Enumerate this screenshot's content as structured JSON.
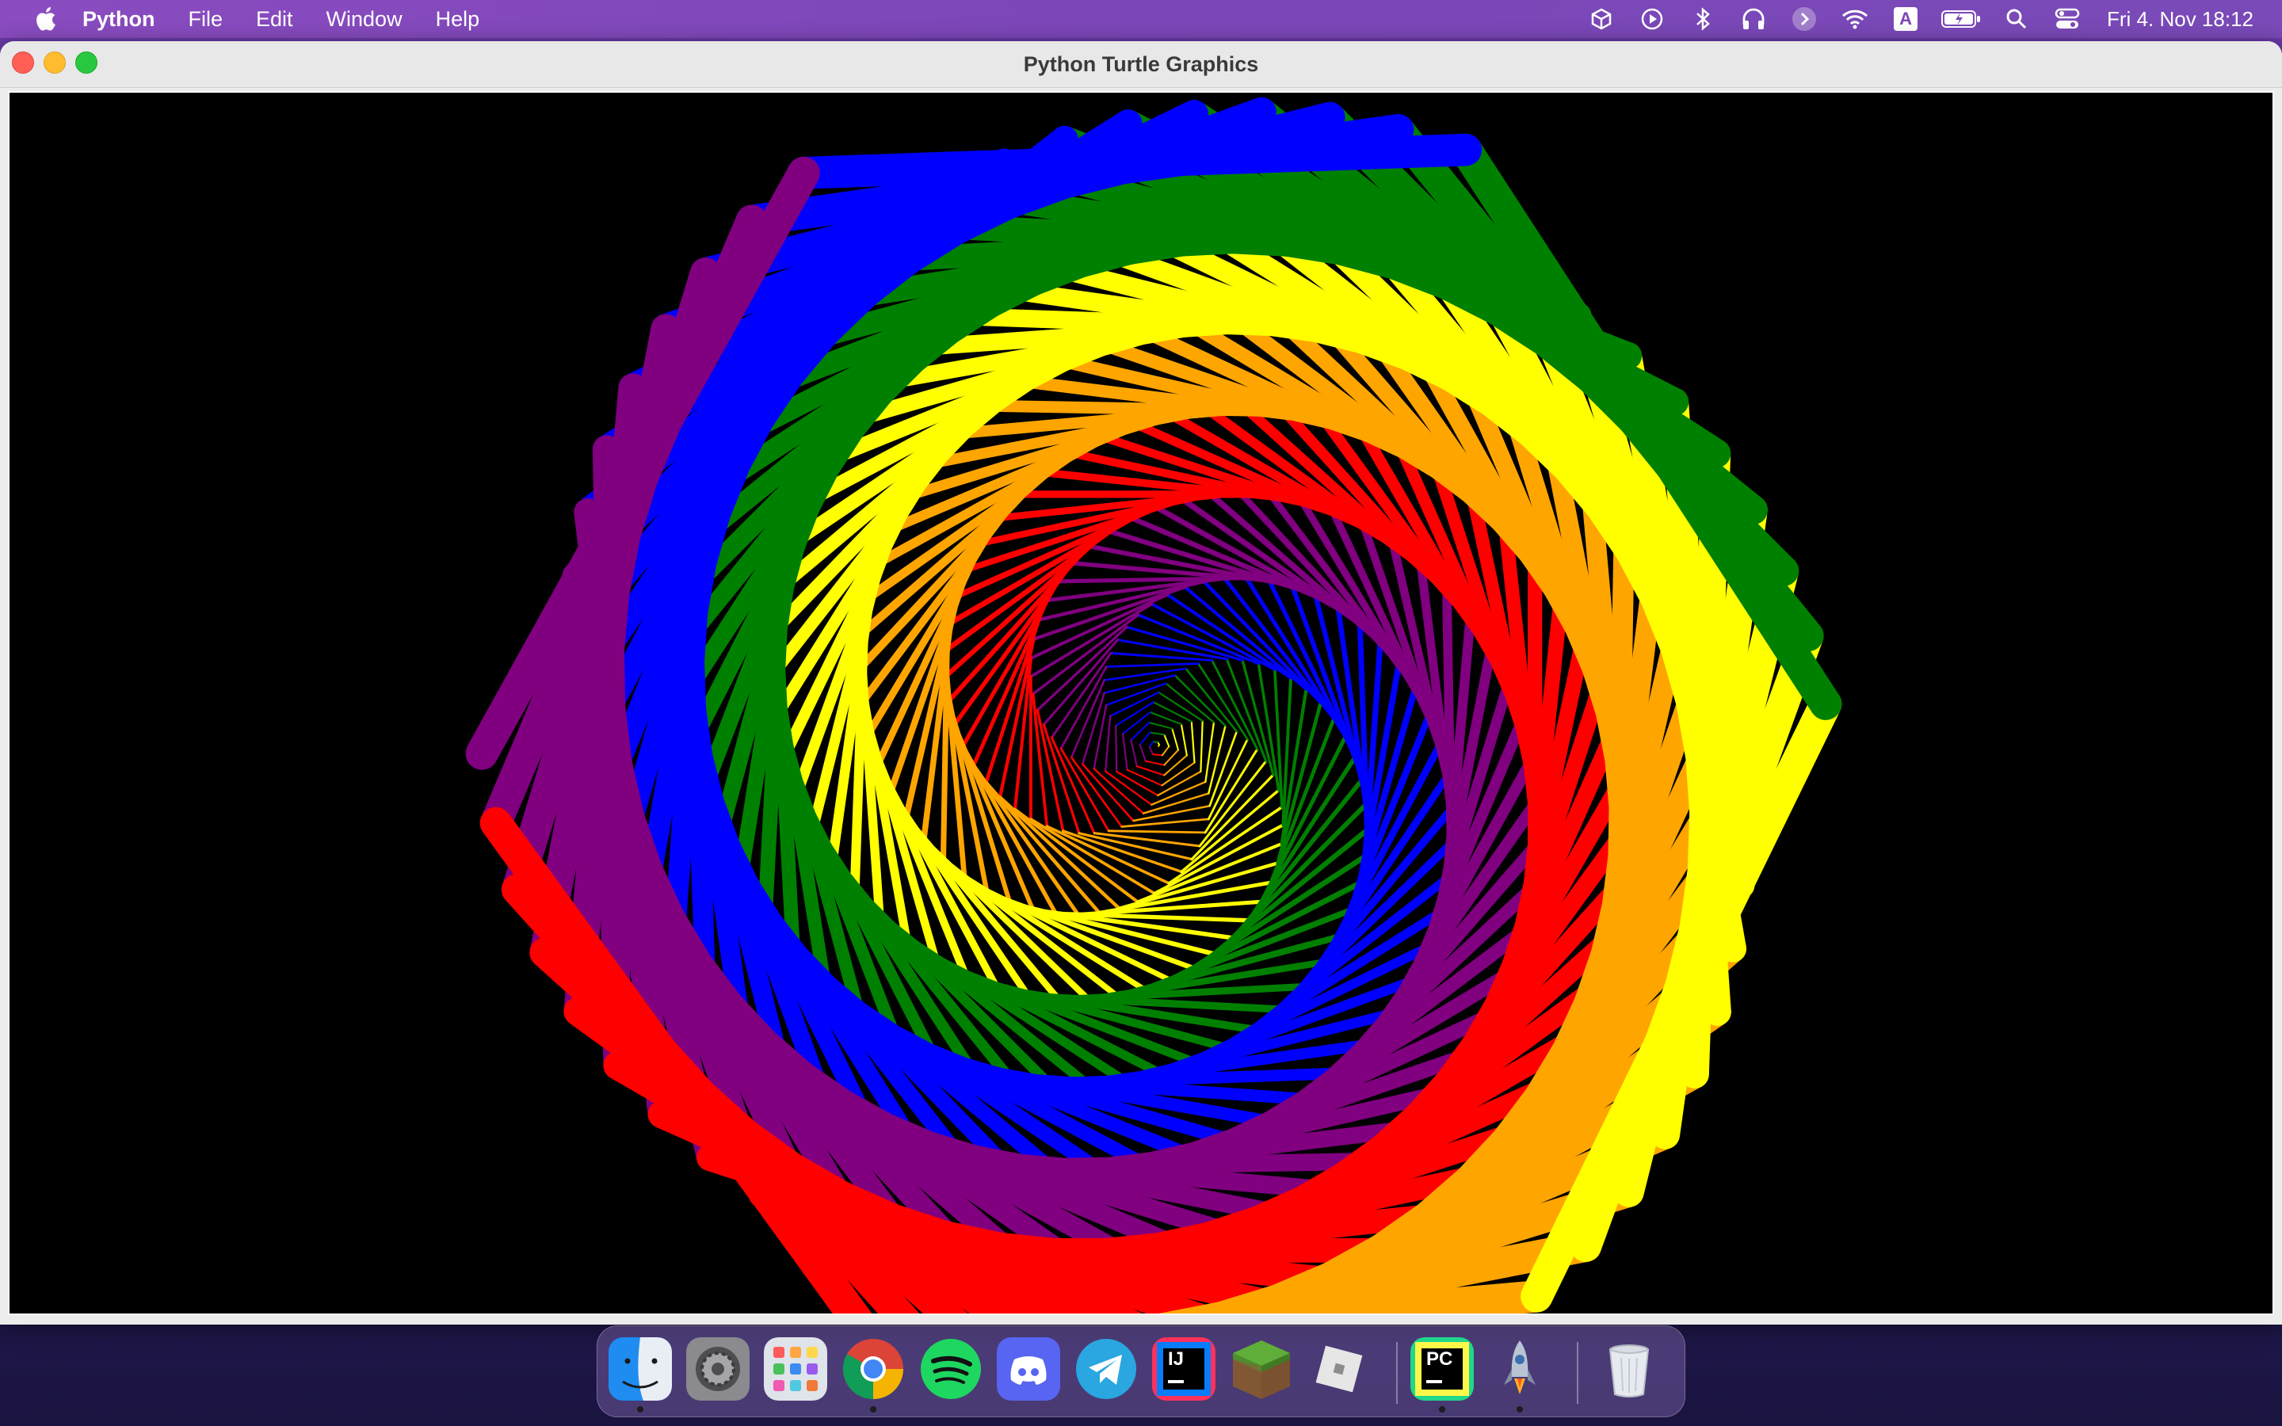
{
  "menubar": {
    "app_name": "Python",
    "menus": [
      "File",
      "Edit",
      "Window",
      "Help"
    ],
    "status_icons": [
      "box-icon",
      "play-icon",
      "bluetooth-icon",
      "headphones-icon",
      "arrow-icon",
      "wifi-icon",
      "input-source-icon",
      "battery-icon",
      "search-icon",
      "control-center-icon"
    ],
    "input_source_label": "A",
    "clock": "Fri 4. Nov  18:12"
  },
  "window": {
    "title": "Python Turtle Graphics",
    "canvas_background": "#000000",
    "spiral_colors": [
      "#ff0000",
      "#ffa500",
      "#ffff00",
      "#008000",
      "#0000ff",
      "#800080"
    ]
  },
  "dock": {
    "apps": [
      {
        "name": "finder",
        "running": true
      },
      {
        "name": "system-preferences",
        "running": false
      },
      {
        "name": "launchpad",
        "running": false
      },
      {
        "name": "chrome",
        "running": true
      },
      {
        "name": "spotify",
        "running": false
      },
      {
        "name": "discord",
        "running": false
      },
      {
        "name": "telegram",
        "running": false
      },
      {
        "name": "intellij",
        "running": false,
        "label": "IJ"
      },
      {
        "name": "minecraft",
        "running": false
      },
      {
        "name": "roblox",
        "running": false
      },
      {
        "name": "pycharm",
        "running": true,
        "label": "PC"
      },
      {
        "name": "python-launcher",
        "running": true
      },
      {
        "name": "trash",
        "running": false
      }
    ]
  }
}
